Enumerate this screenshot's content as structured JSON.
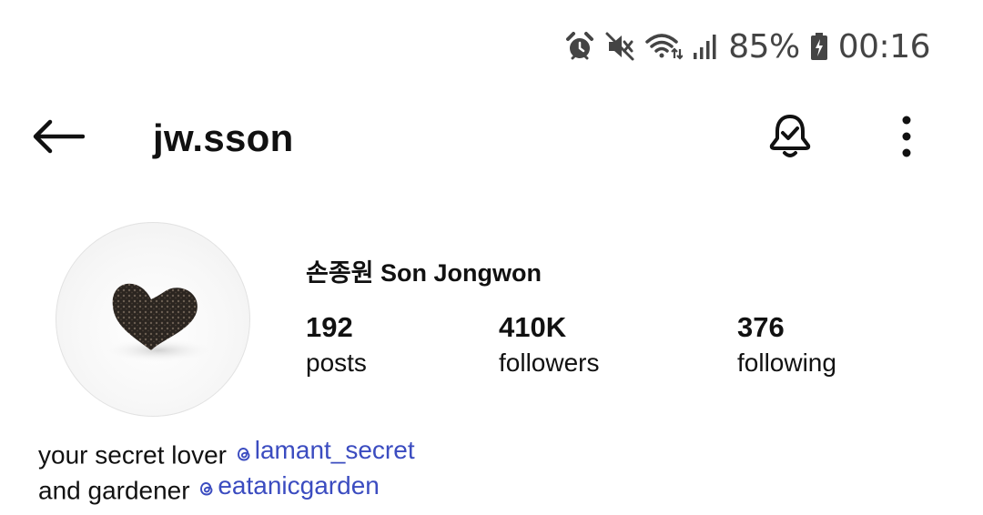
{
  "status_bar": {
    "battery_percent": "85%",
    "time": "00:16",
    "icons": [
      "alarm-icon",
      "mute-icon",
      "wifi-icon",
      "signal-icon",
      "battery-charging-icon"
    ]
  },
  "header": {
    "username": "jw.sson",
    "back_icon": "back-arrow-icon",
    "bell_icon": "notification-bell-check-icon",
    "more_icon": "more-vertical-icon"
  },
  "profile": {
    "display_name": "손종원 Son Jongwon",
    "stats": {
      "posts": {
        "count": "192",
        "label": "posts"
      },
      "followers": {
        "count": "410K",
        "label": "followers"
      },
      "following": {
        "count": "376",
        "label": "following"
      }
    }
  },
  "bio": {
    "line1_text": "your secret lover ",
    "line1_mention": "lamant_secret",
    "line2_text": "and gardener ",
    "line2_mention": "eatanicgarden"
  },
  "colors": {
    "mention": "#3b4cc0",
    "text": "#111111",
    "status": "#444444"
  }
}
